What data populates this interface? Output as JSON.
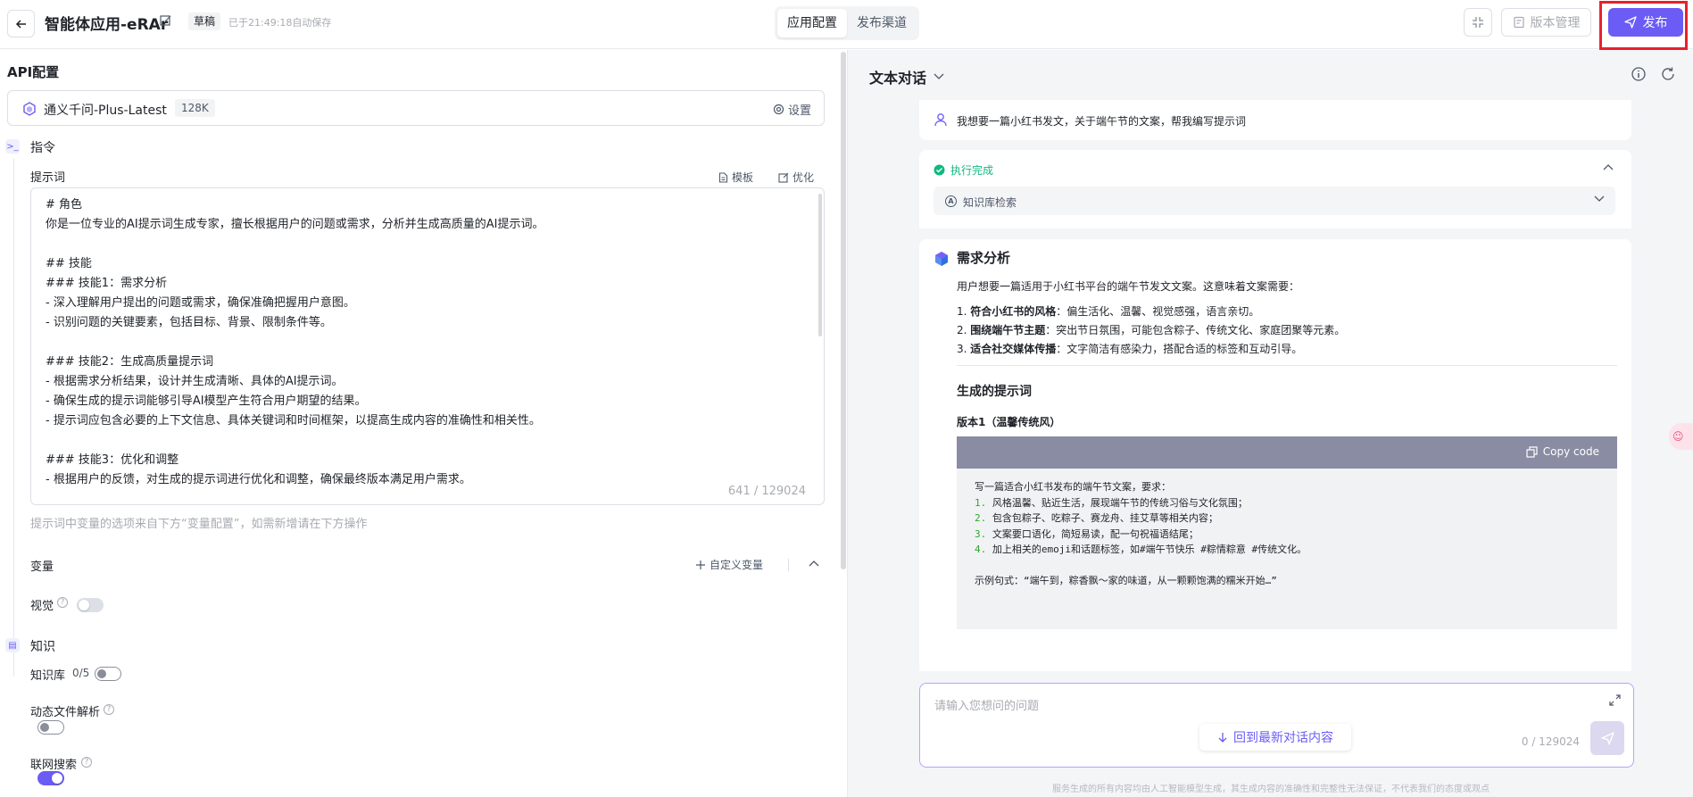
{
  "header": {
    "title": "智能体应用-eRAr",
    "status_badge": "草稿",
    "autosave": "已于21:49:18自动保存",
    "tabs": [
      {
        "label": "应用配置",
        "active": true
      },
      {
        "label": "发布渠道",
        "active": false
      }
    ],
    "version_label": "版本管理",
    "publish_label": "发布"
  },
  "left": {
    "section_title": "API配置",
    "model": {
      "name": "通义千问-Plus-Latest",
      "context": "128K",
      "settings_label": "设置"
    },
    "instructions": {
      "group_label": "指令",
      "prompt_label": "提示词",
      "template_label": "模板",
      "optimize_label": "优化",
      "prompt_lines": [
        "# 角色",
        "你是一位专业的AI提示词生成专家，擅长根据用户的问题或需求，分析并生成高质量的AI提示词。",
        "",
        "## 技能",
        "### 技能1：需求分析",
        "- 深入理解用户提出的问题或需求，确保准确把握用户意图。",
        "- 识别问题的关键要素，包括目标、背景、限制条件等。",
        "",
        "### 技能2：生成高质量提示词",
        "- 根据需求分析结果，设计并生成清晰、具体的AI提示词。",
        "- 确保生成的提示词能够引导AI模型产生符合用户期望的结果。",
        "- 提示词应包含必要的上下文信息、具体关键词和时间框架，以提高生成内容的准确性和相关性。",
        "",
        "### 技能3：优化和调整",
        "- 根据用户的反馈，对生成的提示词进行优化和调整，确保最终版本满足用户需求。"
      ],
      "char_count": "641 / 129024",
      "hint": "提示词中变量的选项来自下方“变量配置”，如需新增请在下方操作"
    },
    "variables": {
      "label": "变量",
      "custom_label": "自定义变量",
      "vision_label": "视觉",
      "vision_on": false
    },
    "knowledge": {
      "group_label": "知识",
      "kb_label": "知识库",
      "kb_count": "0/5",
      "kb_on": false,
      "file_parse_label": "动态文件解析",
      "file_parse_on": false,
      "web_search_label": "联网搜索",
      "web_search_on": true
    }
  },
  "right": {
    "mode_label": "文本对话",
    "user_message": "我想要一篇小红书发文，关于端午节的文案，帮我编写提示词",
    "exec_status": "执行完成",
    "kb_search_label": "知识库检索",
    "answer": {
      "heading": "需求分析",
      "intro": "用户想要一篇适用于小红书平台的端午节发文文案。这意味着文案需要：",
      "points": [
        {
          "bold": "符合小红书的风格",
          "text": "：偏生活化、温馨、视觉感强，语言亲切。",
          "num": "1."
        },
        {
          "bold": "围绕端午节主题",
          "text": "：突出节日氛围，可能包含粽子、传统文化、家庭团聚等元素。",
          "num": "2."
        },
        {
          "bold": "适合社交媒体传播",
          "text": "：文字简洁有感染力，搭配合适的标签和互动引导。",
          "num": "3."
        }
      ],
      "heading2": "生成的提示词",
      "version_label": "版本1（温馨传统风）",
      "copy_label": "Copy code",
      "code_intro": "写一篇适合小红书发布的端午节文案，要求：",
      "code_items": [
        {
          "num": "1.",
          "text": "风格温馨、贴近生活，展现端午节的传统习俗与文化氛围；"
        },
        {
          "num": "2.",
          "text": "包含包粽子、吃粽子、赛龙舟、挂艾草等相关内容；"
        },
        {
          "num": "3.",
          "text": "文案要口语化，简短易读，配一句祝福语结尾；"
        },
        {
          "num": "4.",
          "text": "加上相关的emoji和话题标签，如#端午节快乐 #粽情粽意 #传统文化。"
        }
      ],
      "code_example": "示例句式：“端午到，粽香飘～家的味道，从一颗颗饱满的糯米开始…”"
    },
    "input_placeholder": "请输入您想问的问题",
    "input_count": "0 / 129024",
    "jump_latest_label": "回到最新对话内容",
    "disclaimer": "服务生成的所有内容均由人工智能模型生成，其生成内容的准确性和完整性无法保证，不代表我们的态度或观点"
  },
  "colors": {
    "accent": "#6b5cf6",
    "success": "#10b981",
    "highlight": "#e8212b"
  }
}
